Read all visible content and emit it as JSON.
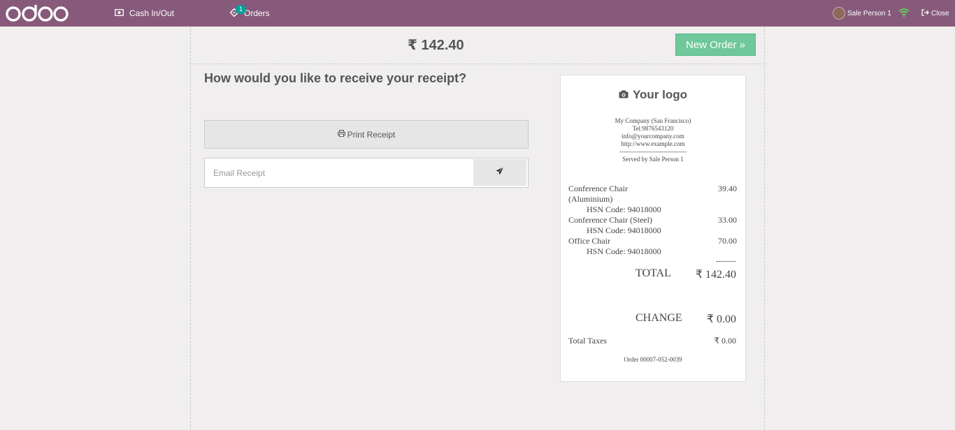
{
  "topbar": {
    "logo_text": "odoo",
    "cash_label": "Cash In/Out",
    "cash_icon": "money-icon",
    "orders_label": "Orders",
    "orders_badge": "1",
    "orders_icon": "ticket-icon",
    "user_name": "Sale Person 1",
    "wifi_icon": "wifi-icon",
    "close_label": "Close",
    "bg_color": "#875a7b"
  },
  "payment": {
    "total": "₹ 142.40",
    "new_order_label": "New Order »",
    "question": "How would you like to receive your receipt?",
    "print_label": "Print Receipt",
    "email_placeholder": "Email Receipt",
    "accent_color": "#6ec89b"
  },
  "receipt": {
    "logo_text": "Your logo",
    "company": "My Company (San Francisco)",
    "tel": "Tel:9876543120",
    "email": "info@yourcompany.com",
    "website": "http://www.example.com",
    "separator": "--------------------------------",
    "served_by": "Served by Sale Person 1",
    "lines": [
      {
        "name": "Conference Chair (Aluminium)",
        "price": "39.40",
        "hsn": "HSN Code: 94018000"
      },
      {
        "name": "Conference Chair (Steel)",
        "price": "33.00",
        "hsn": "HSN Code: 94018000"
      },
      {
        "name": "Office Chair",
        "price": "70.00",
        "hsn": "HSN Code: 94018000"
      }
    ],
    "dash": "--------",
    "total_label": "TOTAL",
    "total_value": "₹ 142.40",
    "change_label": "CHANGE",
    "change_value": "₹ 0.00",
    "taxes_label": "Total Taxes",
    "taxes_value": "₹ 0.00",
    "order_ref": "Order 00007-052-0039"
  }
}
